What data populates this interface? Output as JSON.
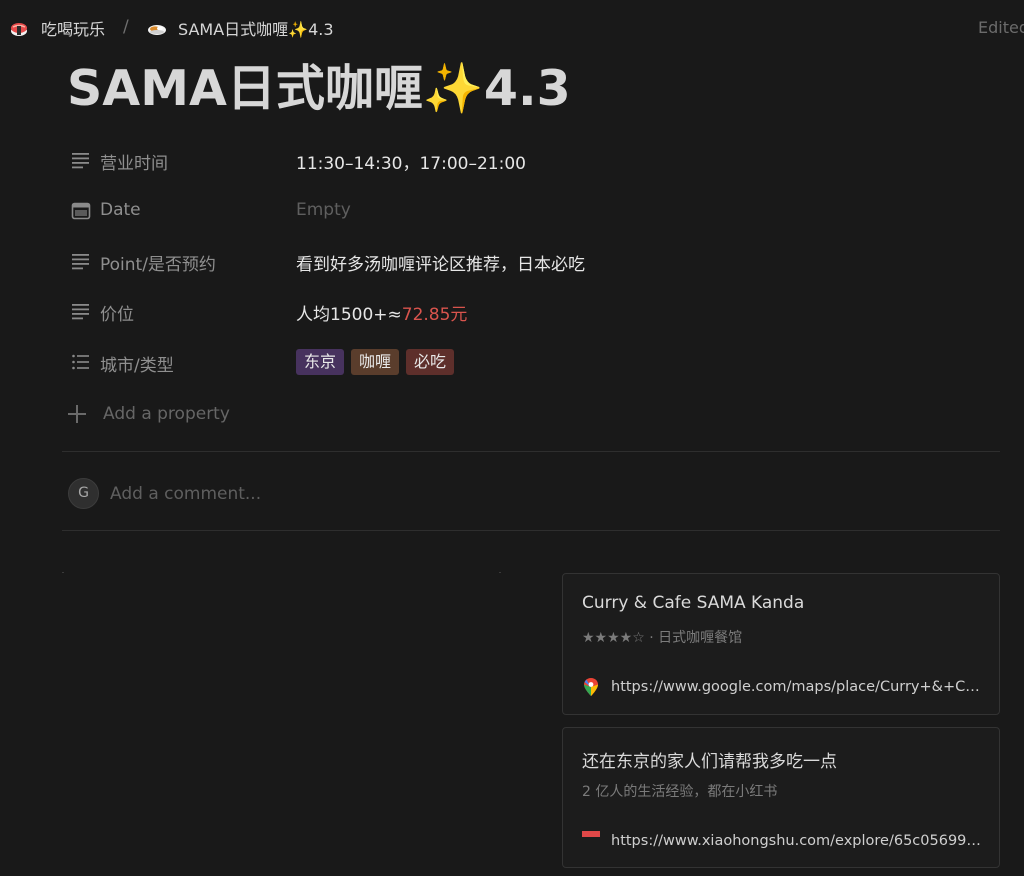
{
  "breadcrumb": {
    "parent_label": "吃喝玩乐",
    "separator": "/",
    "current_label": "SAMA日式咖喱✨4.3"
  },
  "edited_label": "Edited",
  "page_title": "SAMA日式咖喱✨4.3",
  "properties": {
    "hours": {
      "label": "营业时间",
      "value": "11:30–14:30，17:00–21:00"
    },
    "date": {
      "label": "Date",
      "value": "Empty"
    },
    "point": {
      "label": "Point/是否预约",
      "value": "看到好多汤咖喱评论区推荐，日本必吃"
    },
    "price": {
      "label": "价位",
      "value_prefix": "人均1500+≈",
      "value_converted": "72.85元"
    },
    "city": {
      "label": "城市/类型",
      "tags": [
        {
          "text": "东京",
          "color": "#47325e"
        },
        {
          "text": "咖喱",
          "color": "#5a3d2c"
        },
        {
          "text": "必吃",
          "color": "#5e2f2b"
        }
      ]
    }
  },
  "add_property_label": "Add a property",
  "comment": {
    "avatar_initial": "G",
    "placeholder": "Add a comment..."
  },
  "bookmarks": [
    {
      "title": "Curry & Cafe SAMA Kanda",
      "description": "★★★★☆ · 日式咖喱餐馆",
      "url": "https://www.google.com/maps/place/Curry+&+Cafe+SAMA+Kanda"
    },
    {
      "title": "还在东京的家人们请帮我多吃一点",
      "description": "2 亿人的生活经验，都在小红书",
      "url": "https://www.xiaohongshu.com/explore/65c056990000000010000000"
    }
  ],
  "colors": {
    "background": "#191919",
    "price_red": "#d9544d",
    "xiaohongshu_red": "#e04848"
  }
}
